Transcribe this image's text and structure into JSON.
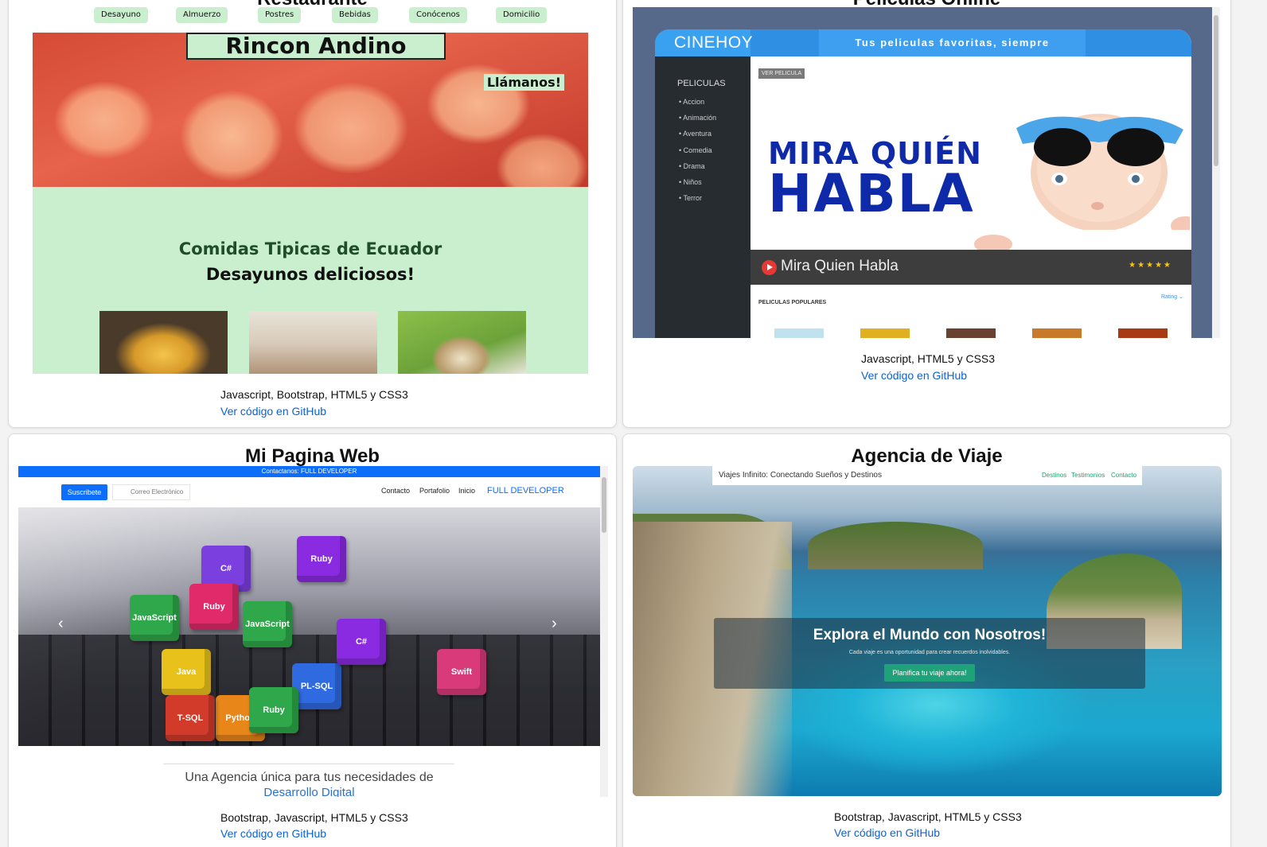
{
  "cards": [
    {
      "title": "Restaurante",
      "tech": "Javascript, Bootstrap, HTML5 y CSS3",
      "link": "Ver código en GitHub",
      "preview": {
        "nav": [
          "Desayuno",
          "Almuerzo",
          "Postres",
          "Bebidas",
          "Conócenos",
          "Domicilio"
        ],
        "brand": "Rincon Andino",
        "call": "Llámanos!",
        "heading1": "Comidas Tipicas de Ecuador",
        "heading2": "Desayunos deliciosos!"
      }
    },
    {
      "title": "Peliculas Online",
      "tech": "Javascript, HTML5 y CSS3",
      "link": "Ver código en GitHub",
      "preview": {
        "logo": "CINEHOY",
        "tagline": "Tus peliculas favoritas, siempre disponibles",
        "sidebar_title": "PELICULAS",
        "genres": [
          "Accion",
          "Animación",
          "Aventura",
          "Comedia",
          "Drama",
          "Niños",
          "Terror"
        ],
        "button": "VER PELICULA",
        "poster_line1": "MIRA QUIÉN",
        "poster_line2": "HABLA",
        "movie_title": "Mira Quien Habla",
        "stars": "★★★★★",
        "section": "PELICULAS POPULARES",
        "rating": "Rating ⌄"
      }
    },
    {
      "title": "Mi Pagina Web",
      "tech": "Bootstrap, Javascript, HTML5 y CSS3",
      "link": "Ver código en GitHub",
      "preview": {
        "topbar": "Contactanos: FULL DEVELOPER",
        "subscribe": "Suscribete",
        "email_placeholder": "Correo Electrónico",
        "links": [
          "Contacto",
          "Portafolio",
          "Inicio"
        ],
        "brand": "FULL DEVELOPER",
        "cubes": [
          "C#",
          "Ruby",
          "JavaScript",
          "Java",
          "Python",
          "T-SQL",
          "PL-SQL",
          "Swift",
          "C#",
          "Ruby",
          "JavaScript",
          "Ruby"
        ],
        "desc1": "Una Agencia única para tus necesidades de",
        "desc2": "Desarrollo Digital"
      }
    },
    {
      "title": "Agencia de Viaje",
      "tech": "Bootstrap, Javascript, HTML5 y CSS3",
      "link": "Ver código en GitHub",
      "preview": {
        "brand": "Viajes Infinito: Conectando Sueños y Destinos",
        "links": [
          "Destinos",
          "Testimonios",
          "Contacto"
        ],
        "heading": "Explora el Mundo con Nosotros!",
        "sub": "Cada viaje es una oportunidad para crear recuerdos inolvidables.",
        "button": "Planifica tu viaje ahora!"
      }
    }
  ]
}
